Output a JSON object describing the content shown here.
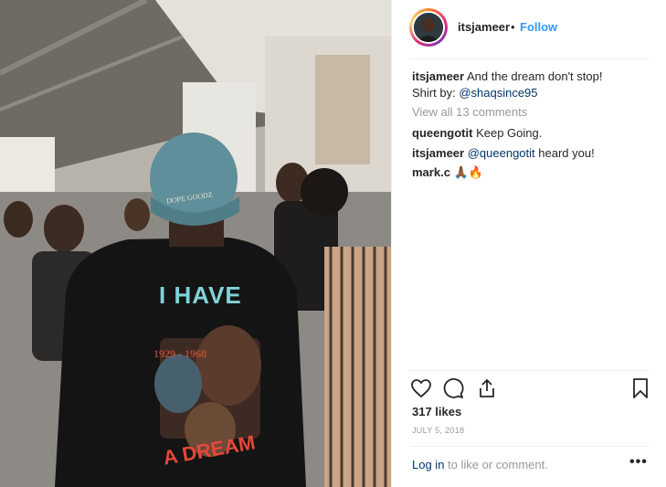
{
  "post": {
    "image_alt_visible": "",
    "shirt_text_top": "I HAVE",
    "shirt_text_bottom": "A DREAM",
    "shirt_years": "1929 - 1968",
    "hat_text": "DOPE GOODZ"
  },
  "header": {
    "username": "itsjameer",
    "separator": "•",
    "follow_label": "Follow"
  },
  "caption": {
    "username": "itsjameer",
    "text": "And the dream don't stop!",
    "shirt_prefix": "Shirt by:",
    "shirt_handle": "@shaqsince95"
  },
  "comments": {
    "view_all": "View all 13 comments",
    "items": [
      {
        "user": "queengotit",
        "text": "Keep Going."
      },
      {
        "user": "itsjameer",
        "mention": "@queengotit",
        "text": "heard you!"
      },
      {
        "user": "mark.c",
        "text": "🙏🏾🔥"
      }
    ]
  },
  "actions": {
    "like_icon": "heart-icon",
    "comment_icon": "comment-bubble-icon",
    "share_icon": "share-icon",
    "save_icon": "bookmark-icon"
  },
  "likes": "317 likes",
  "date": "JULY 5, 2018",
  "footer": {
    "login_label": "Log in",
    "rest": "to like or comment.",
    "more_label": "•••"
  },
  "colors": {
    "link_blue": "#3897f0",
    "dark_link": "#003569",
    "muted": "#999999",
    "text": "#262626"
  }
}
